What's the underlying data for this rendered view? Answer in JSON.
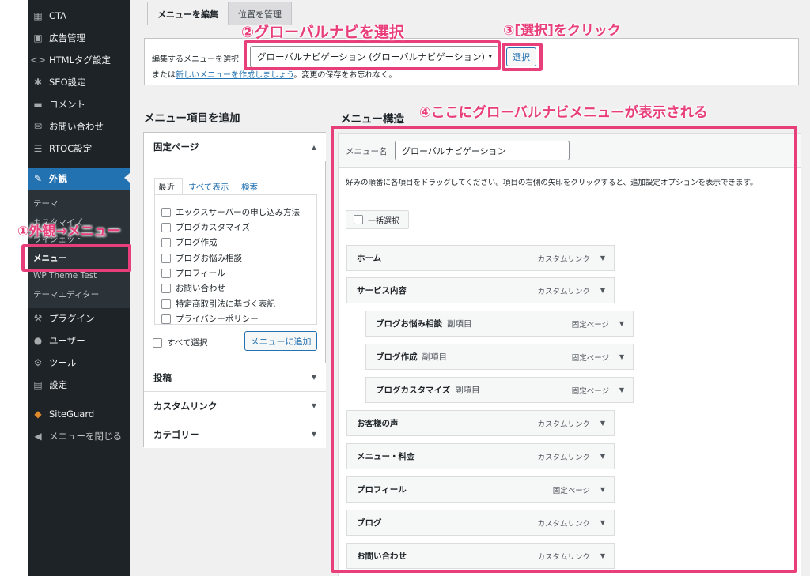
{
  "sidebar": {
    "items": [
      {
        "label": "CTA",
        "icon": "cta-icon"
      },
      {
        "label": "広告管理",
        "icon": "ad-icon"
      },
      {
        "label": "HTMLタグ設定",
        "icon": "code-icon"
      },
      {
        "label": "SEO設定",
        "icon": "gear-icon"
      },
      {
        "label": "コメント",
        "icon": "comment-icon"
      },
      {
        "label": "お問い合わせ",
        "icon": "mail-icon"
      },
      {
        "label": "RTOC設定",
        "icon": "list-icon"
      },
      {
        "label": "外観",
        "icon": "brush-icon"
      },
      {
        "label": "プラグイン",
        "icon": "plugin-icon"
      },
      {
        "label": "ユーザー",
        "icon": "user-icon"
      },
      {
        "label": "ツール",
        "icon": "wrench-icon"
      },
      {
        "label": "設定",
        "icon": "settings-icon"
      },
      {
        "label": "SiteGuard",
        "icon": "shield-icon"
      },
      {
        "label": "メニューを閉じる",
        "icon": "collapse-icon"
      }
    ],
    "submenu": [
      "テーマ",
      "カスタマイズ",
      "ウィジェット",
      "メニュー",
      "WP Theme Test",
      "テーマエディター"
    ]
  },
  "tabs": {
    "edit": "メニューを編集",
    "manage": "位置を管理"
  },
  "select_bar": {
    "label": "編集するメニューを選択",
    "selected": "グローバルナビゲーション (グローバルナビゲーション)",
    "button": "選択",
    "or_prefix": "または",
    "create_link": "新しいメニューを作成しましょう",
    "suffix": "。変更の保存をお忘れなく。"
  },
  "add_items": {
    "heading": "メニュー項目を追加",
    "fixed_page": "固定ページ",
    "subtabs": [
      "最近",
      "すべて表示",
      "検索"
    ],
    "pages": [
      "エックスサーバーの申し込み方法",
      "ブログカスタマイズ",
      "ブログ作成",
      "ブログお悩み相談",
      "プロフィール",
      "お問い合わせ",
      "特定商取引法に基づく表記",
      "プライバシーポリシー"
    ],
    "select_all": "すべて選択",
    "add_button": "メニューに追加",
    "sections": [
      "投稿",
      "カスタムリンク",
      "カテゴリー"
    ]
  },
  "structure": {
    "heading": "メニュー構造",
    "name_label": "メニュー名",
    "name_value": "グローバルナビゲーション",
    "instructions": "好みの順番に各項目をドラッグしてください。項目の右側の矢印をクリックすると、追加設定オプションを表示できます。",
    "bulk_select": "一括選択",
    "subitem_tag": "副項目",
    "items": [
      {
        "title": "ホーム",
        "type": "カスタムリンク"
      },
      {
        "title": "サービス内容",
        "type": "カスタムリンク"
      },
      {
        "title": "ブログお悩み相談",
        "type": "固定ページ"
      },
      {
        "title": "ブログ作成",
        "type": "固定ページ"
      },
      {
        "title": "ブログカスタマイズ",
        "type": "固定ページ"
      },
      {
        "title": "お客様の声",
        "type": "カスタムリンク"
      },
      {
        "title": "メニュー・料金",
        "type": "カスタムリンク"
      },
      {
        "title": "プロフィール",
        "type": "固定ページ"
      },
      {
        "title": "ブログ",
        "type": "カスタムリンク"
      },
      {
        "title": "お問い合わせ",
        "type": "カスタムリンク"
      }
    ]
  },
  "annotations": {
    "a1": "①外観→メニュー",
    "a2": "②グローバルナビを選択",
    "a3": "③[選択]をクリック",
    "a4": "④ここにグローバルナビメニューが表示される"
  },
  "colors": {
    "accent": "#2271b1",
    "annotation": "#e83e7a",
    "sidebar": "#1d2327"
  }
}
